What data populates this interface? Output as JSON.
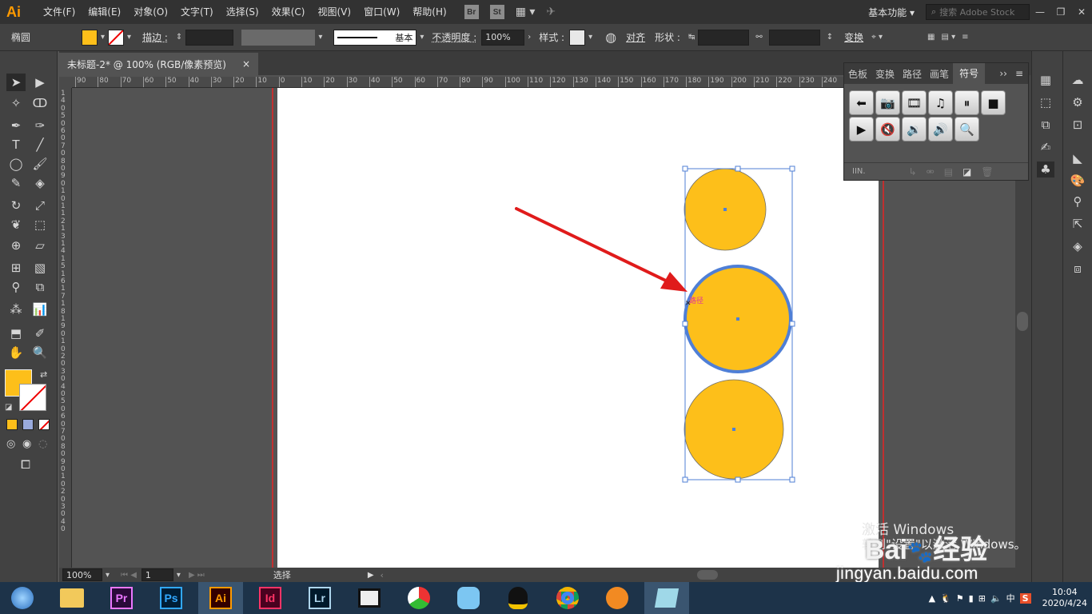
{
  "menubar": {
    "logo": "Ai",
    "menus": [
      "文件(F)",
      "编辑(E)",
      "对象(O)",
      "文字(T)",
      "选择(S)",
      "效果(C)",
      "视图(V)",
      "窗口(W)",
      "帮助(H)"
    ],
    "bridge": "Br",
    "stock": "St",
    "workspace": "基本功能",
    "search_placeholder": "搜索 Adobe Stock"
  },
  "control": {
    "object_type": "椭圆",
    "fill_color": "#fdbf1a",
    "stroke_label": "描边 :",
    "brush_label": "基本",
    "opacity_label": "不透明度 :",
    "opacity_value": "100%",
    "style_label": "样式 :",
    "align_label": "对齐",
    "shape_label": "形状 :",
    "transform_label": "变换"
  },
  "document": {
    "tab_title": "未标题-2* @ 100% (RGB/像素预览)",
    "close": "×"
  },
  "ruler": {
    "h_ticks": [
      "90",
      "80",
      "70",
      "60",
      "50",
      "40",
      "30",
      "20",
      "10",
      "0",
      "10",
      "20",
      "30",
      "40",
      "50",
      "60",
      "70",
      "80",
      "90",
      "100",
      "110",
      "120",
      "130",
      "140",
      "150",
      "160",
      "170",
      "180",
      "190",
      "200",
      "210",
      "220",
      "230",
      "240"
    ],
    "v_ticks": [
      "1",
      "4",
      "0",
      "5",
      "0",
      "6",
      "0",
      "7",
      "0",
      "8",
      "0",
      "9",
      "0",
      "1",
      "0",
      "1",
      "1",
      "2",
      "1",
      "3",
      "1",
      "4",
      "1",
      "5",
      "1",
      "6",
      "1",
      "7",
      "1",
      "8",
      "1",
      "9",
      "0",
      "1",
      "0",
      "2",
      "0",
      "3",
      "0",
      "4",
      "0",
      "5",
      "0",
      "6",
      "0",
      "7",
      "0",
      "8",
      "0",
      "9",
      "0",
      "1",
      "0",
      "2",
      "0",
      "3",
      "0",
      "4",
      "0"
    ]
  },
  "canvas": {
    "shape_color": "#fdbf1a",
    "selection_color": "#4f7fd6",
    "arrow_color": "#e01b1b",
    "path_label": "路径"
  },
  "symbols_panel": {
    "tabs": [
      "色板",
      "变换",
      "路径",
      "画笔",
      "符号"
    ],
    "expand": "››",
    "menu": "≡",
    "lib_icon": "IIN."
  },
  "status": {
    "zoom": "100%",
    "page": "1",
    "mode": "选择"
  },
  "taskbar": {
    "apps": [
      {
        "label": "Pr",
        "color": "#ea77ff",
        "bg": "#2a0a3a"
      },
      {
        "label": "Ps",
        "color": "#31a8ff",
        "bg": "#001e36"
      },
      {
        "label": "Ai",
        "color": "#ff9a00",
        "bg": "#330000"
      },
      {
        "label": "Id",
        "color": "#ff3366",
        "bg": "#49021f"
      },
      {
        "label": "Lr",
        "color": "#add5ec",
        "bg": "#001a2b"
      }
    ],
    "ime": "中",
    "time": "10:04",
    "date": "2020/4/24"
  },
  "watermark": {
    "activate_line1": "激活 Windows",
    "activate_line2": "转到\"设置\"以激活 Windows。",
    "brand": "Bai",
    "brand2": "经验",
    "url": "jingyan.baidu.com"
  }
}
